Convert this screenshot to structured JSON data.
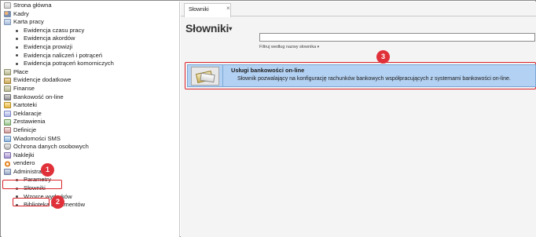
{
  "sidebar": {
    "items": [
      {
        "label": "Strona główna",
        "level": 0,
        "icon": "home-icon"
      },
      {
        "label": "Kadry",
        "level": 0,
        "icon": "people-icon"
      },
      {
        "label": "Karta pracy",
        "level": 0,
        "icon": "card-icon"
      },
      {
        "label": "Ewidencja czasu pracy",
        "level": 1
      },
      {
        "label": "Ewidencja akordów",
        "level": 1
      },
      {
        "label": "Ewidencja prowizji",
        "level": 1
      },
      {
        "label": "Ewidencja naliczeń i potrąceń",
        "level": 1
      },
      {
        "label": "Ewidencja potrąceń komorniczych",
        "level": 1
      },
      {
        "label": "Płace",
        "level": 0,
        "icon": "money-icon"
      },
      {
        "label": "Ewidencje dodatkowe",
        "level": 0,
        "icon": "chart-icon"
      },
      {
        "label": "Finanse",
        "level": 0,
        "icon": "finance-icon"
      },
      {
        "label": "Bankowość on-line",
        "level": 0,
        "icon": "bank-icon"
      },
      {
        "label": "Kartoteki",
        "level": 0,
        "icon": "folder-icon"
      },
      {
        "label": "Deklaracje",
        "level": 0,
        "icon": "declaration-icon"
      },
      {
        "label": "Zestawienia",
        "level": 0,
        "icon": "report-icon"
      },
      {
        "label": "Definicje",
        "level": 0,
        "icon": "definitions-icon"
      },
      {
        "label": "Wiadomości SMS",
        "level": 0,
        "icon": "sms-icon"
      },
      {
        "label": "Ochrona danych osobowych",
        "level": 0,
        "icon": "shield-icon"
      },
      {
        "label": "Naklejki",
        "level": 0,
        "icon": "tag-icon"
      },
      {
        "label": "vendero",
        "level": 0,
        "icon": "vendero-icon"
      },
      {
        "label": "Administracja",
        "level": 0,
        "icon": "admin-icon"
      },
      {
        "label": "Parametry",
        "level": 1
      },
      {
        "label": "Słowniki",
        "level": 1
      },
      {
        "label": "Wzorce wydruków",
        "level": 1
      },
      {
        "label": "Biblioteka dokumentów",
        "level": 1
      }
    ]
  },
  "badges": {
    "one": "1",
    "two": "2",
    "three": "3"
  },
  "tab": {
    "label": "Słowniki",
    "close": "×"
  },
  "page": {
    "title": "Słowniki",
    "title_caret": "▾"
  },
  "search": {
    "value": "",
    "placeholder": ""
  },
  "filter": {
    "label": "Filtruj według nazwy słownika",
    "caret": "▾"
  },
  "dictionary_row": {
    "title": "Usługi bankowości on-line",
    "description": "Słownik pozwalający na konfigurację rachunków bankowych współpracujących z systemami bankowości on-line."
  },
  "colors": {
    "highlight_red": "#d8232a",
    "badge_red": "#e0313a",
    "selected_row": "#b3d1f2"
  }
}
